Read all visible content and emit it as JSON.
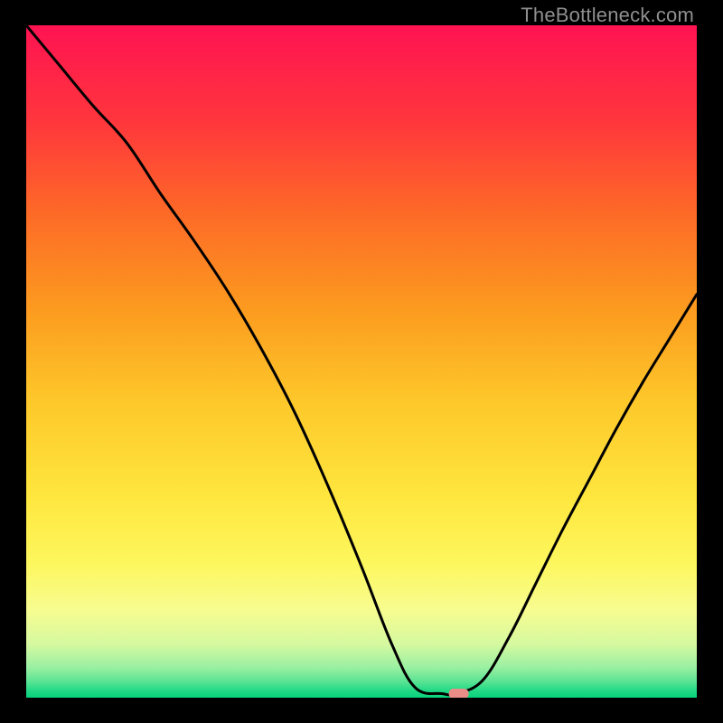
{
  "watermark": "TheBottleneck.com",
  "chart_data": {
    "type": "line",
    "title": "",
    "xlabel": "",
    "ylabel": "",
    "xlim": [
      0,
      100
    ],
    "ylim": [
      0,
      100
    ],
    "x": [
      0,
      5,
      10,
      15,
      20,
      25,
      30,
      35,
      40,
      45,
      50,
      54.5,
      58,
      62,
      64,
      68,
      72,
      76,
      80,
      84,
      88,
      92,
      96,
      100
    ],
    "values": [
      100,
      94,
      88,
      82.5,
      75,
      68,
      60.5,
      52,
      42.5,
      31.5,
      19.5,
      8,
      1.5,
      0.6,
      0.6,
      2.5,
      9,
      17,
      25,
      32.5,
      40,
      47,
      53.5,
      60
    ],
    "notch_x": 64.5,
    "gradient_stops": [
      {
        "pos": 0.0,
        "color": "#ff1352"
      },
      {
        "pos": 0.14,
        "color": "#ff353d"
      },
      {
        "pos": 0.28,
        "color": "#fd6a27"
      },
      {
        "pos": 0.42,
        "color": "#fc9a1f"
      },
      {
        "pos": 0.56,
        "color": "#fdc82a"
      },
      {
        "pos": 0.7,
        "color": "#fee63e"
      },
      {
        "pos": 0.8,
        "color": "#fdf75e"
      },
      {
        "pos": 0.87,
        "color": "#f7fc90"
      },
      {
        "pos": 0.92,
        "color": "#d6f9a0"
      },
      {
        "pos": 0.955,
        "color": "#9af0a2"
      },
      {
        "pos": 0.975,
        "color": "#5de494"
      },
      {
        "pos": 0.99,
        "color": "#20d985"
      },
      {
        "pos": 1.0,
        "color": "#07d17d"
      }
    ],
    "notch_color": "#ea8d88",
    "line_color": "#000000"
  }
}
